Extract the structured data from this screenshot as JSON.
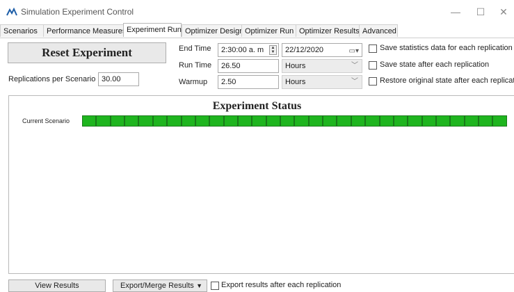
{
  "window": {
    "title": "Simulation Experiment Control",
    "minimize_glyph": "—",
    "maximize_glyph": "☐",
    "close_glyph": "✕"
  },
  "tabs": [
    {
      "label": "Scenarios"
    },
    {
      "label": "Performance Measures"
    },
    {
      "label": "Experiment Run"
    },
    {
      "label": "Optimizer Design"
    },
    {
      "label": "Optimizer Run"
    },
    {
      "label": "Optimizer Results"
    },
    {
      "label": "Advanced"
    }
  ],
  "active_tab": "Experiment Run",
  "run_panel": {
    "reset_label": "Reset Experiment",
    "replications_label": "Replications per Scenario",
    "replications_value": "30.00",
    "end_time_label": "End Time",
    "end_time_value": "2:30:00 a. m",
    "end_date_value": "22/12/2020",
    "run_time_label": "Run Time",
    "run_time_value": "26.50",
    "run_time_unit": "Hours",
    "warmup_label": "Warmup",
    "warmup_value": "2.50",
    "warmup_unit": "Hours",
    "options": [
      {
        "label": "Save statistics data for each replication",
        "checked": false
      },
      {
        "label": "Save state after each replication",
        "checked": false
      },
      {
        "label": "Restore original state after each replication",
        "checked": false
      }
    ]
  },
  "status": {
    "title": "Experiment Status",
    "current_scenario_label": "Current Scenario",
    "progress_fraction": 1.0,
    "segment_count": 30,
    "bar_color": "#1fb51f"
  },
  "bottom": {
    "view_results_label": "View Results",
    "export_label": "Export/Merge Results",
    "export_each_label": "Export results after each replication",
    "export_each_checked": false
  }
}
